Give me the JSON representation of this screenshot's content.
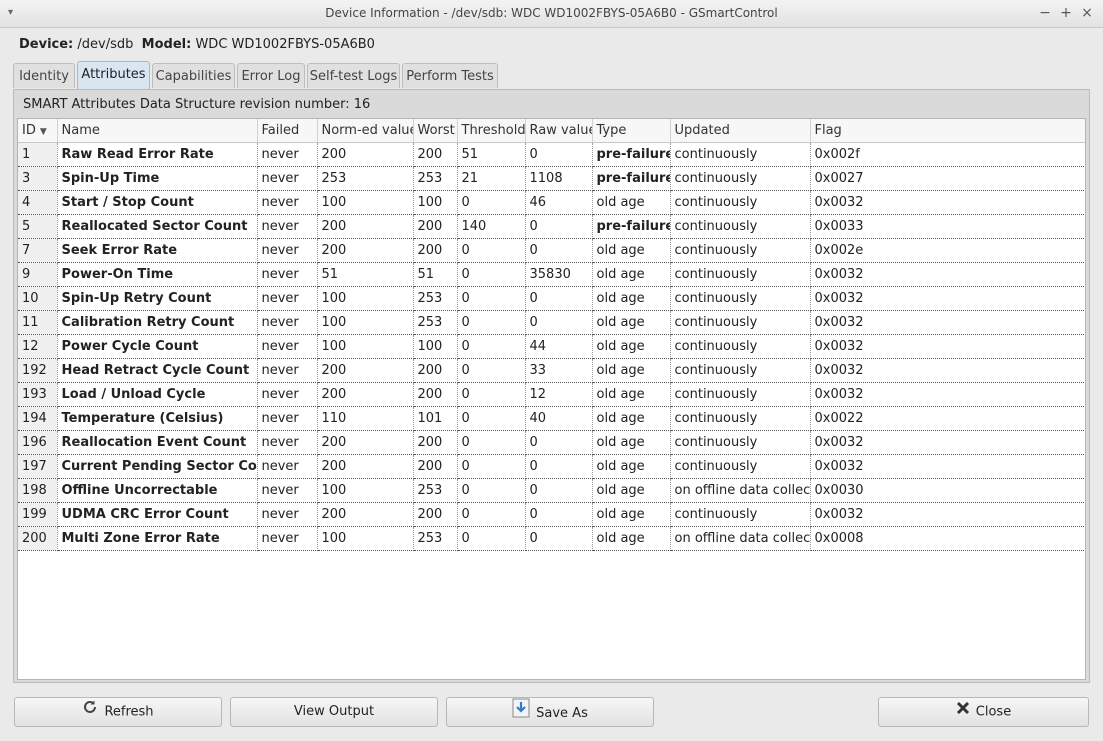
{
  "window": {
    "title": "Device Information - /dev/sdb: WDC WD1002FBYS-05A6B0 - GSmartControl",
    "controls": [
      "−",
      "+",
      "×"
    ]
  },
  "device": {
    "device_label": "Device:",
    "device_value": "/dev/sdb",
    "model_label": "Model:",
    "model_value": "WDC WD1002FBYS-05A6B0"
  },
  "tabs": [
    {
      "label": "Identity",
      "active": false
    },
    {
      "label": "Attributes",
      "active": true
    },
    {
      "label": "Capabilities",
      "active": false
    },
    {
      "label": "Error Log",
      "active": false
    },
    {
      "label": "Self-test Logs",
      "active": false
    },
    {
      "label": "Perform Tests",
      "active": false
    }
  ],
  "revision_text": "SMART Attributes Data Structure revision number: 16",
  "table": {
    "columns": [
      "ID",
      "Name",
      "Failed",
      "Norm-ed value",
      "Worst",
      "Threshold",
      "Raw value",
      "Type",
      "Updated",
      "Flag"
    ],
    "sort_column": "ID",
    "rows": [
      [
        "1",
        "Raw Read Error Rate",
        "never",
        "200",
        "200",
        "51",
        "0",
        "pre-failure",
        "continuously",
        "0x002f"
      ],
      [
        "3",
        "Spin-Up Time",
        "never",
        "253",
        "253",
        "21",
        "1108",
        "pre-failure",
        "continuously",
        "0x0027"
      ],
      [
        "4",
        "Start / Stop Count",
        "never",
        "100",
        "100",
        "0",
        "46",
        "old age",
        "continuously",
        "0x0032"
      ],
      [
        "5",
        "Reallocated Sector Count",
        "never",
        "200",
        "200",
        "140",
        "0",
        "pre-failure",
        "continuously",
        "0x0033"
      ],
      [
        "7",
        "Seek Error Rate",
        "never",
        "200",
        "200",
        "0",
        "0",
        "old age",
        "continuously",
        "0x002e"
      ],
      [
        "9",
        "Power-On Time",
        "never",
        "51",
        "51",
        "0",
        "35830",
        "old age",
        "continuously",
        "0x0032"
      ],
      [
        "10",
        "Spin-Up Retry Count",
        "never",
        "100",
        "253",
        "0",
        "0",
        "old age",
        "continuously",
        "0x0032"
      ],
      [
        "11",
        "Calibration Retry Count",
        "never",
        "100",
        "253",
        "0",
        "0",
        "old age",
        "continuously",
        "0x0032"
      ],
      [
        "12",
        "Power Cycle Count",
        "never",
        "100",
        "100",
        "0",
        "44",
        "old age",
        "continuously",
        "0x0032"
      ],
      [
        "192",
        "Head Retract Cycle Count",
        "never",
        "200",
        "200",
        "0",
        "33",
        "old age",
        "continuously",
        "0x0032"
      ],
      [
        "193",
        "Load / Unload Cycle",
        "never",
        "200",
        "200",
        "0",
        "12",
        "old age",
        "continuously",
        "0x0032"
      ],
      [
        "194",
        "Temperature (Celsius)",
        "never",
        "110",
        "101",
        "0",
        "40",
        "old age",
        "continuously",
        "0x0022"
      ],
      [
        "196",
        "Reallocation Event Count",
        "never",
        "200",
        "200",
        "0",
        "0",
        "old age",
        "continuously",
        "0x0032"
      ],
      [
        "197",
        "Current Pending Sector Count",
        "never",
        "200",
        "200",
        "0",
        "0",
        "old age",
        "continuously",
        "0x0032"
      ],
      [
        "198",
        "Offline Uncorrectable",
        "never",
        "100",
        "253",
        "0",
        "0",
        "old age",
        "on offline data collect.",
        "0x0030"
      ],
      [
        "199",
        "UDMA CRC Error Count",
        "never",
        "200",
        "200",
        "0",
        "0",
        "old age",
        "continuously",
        "0x0032"
      ],
      [
        "200",
        "Multi Zone Error Rate",
        "never",
        "100",
        "253",
        "0",
        "0",
        "old age",
        "on offline data collect.",
        "0x0008"
      ]
    ]
  },
  "buttons": {
    "refresh": {
      "label": "Refresh",
      "icon": "refresh-icon"
    },
    "view_output": {
      "label": "View Output"
    },
    "save_as": {
      "label": "Save As",
      "icon": "save-icon"
    },
    "close": {
      "label": "Close",
      "icon": "close-icon"
    }
  },
  "colors": {
    "active_tab": "#d9e6f2",
    "save_icon_blue": "#2e7bd6"
  }
}
